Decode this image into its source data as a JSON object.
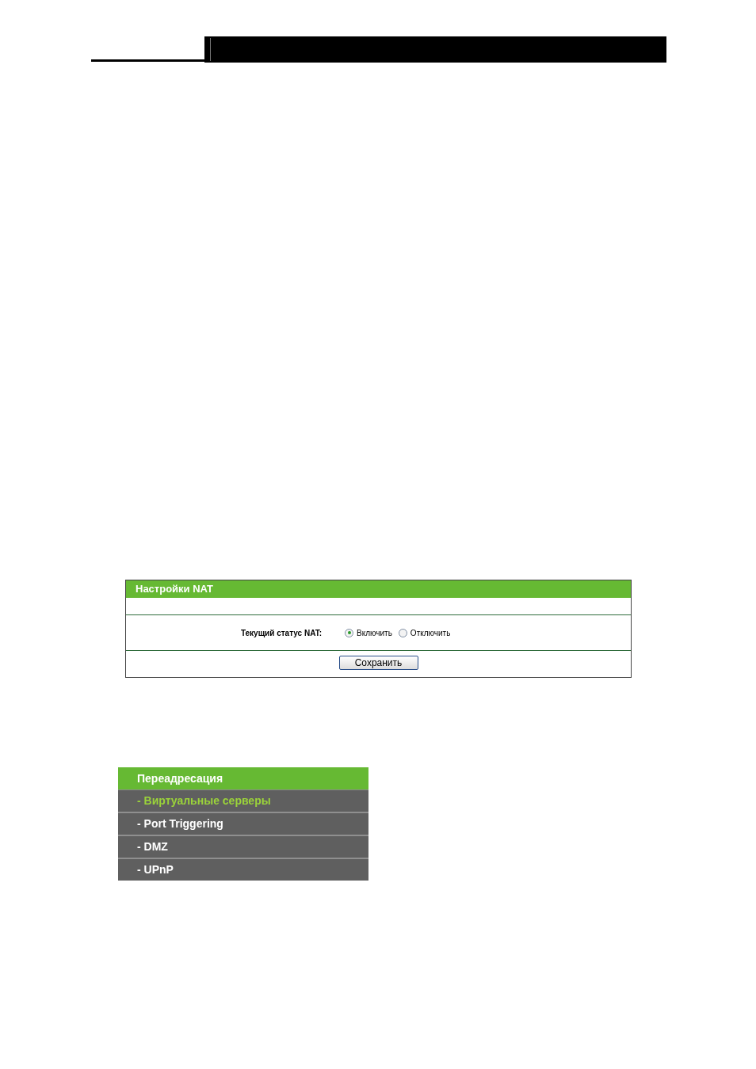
{
  "nat_settings": {
    "title": "Настройки NAT",
    "status_label": "Текущий статус NAT:",
    "options": [
      {
        "label": "Включить",
        "selected": true
      },
      {
        "label": "Отключить",
        "selected": false
      }
    ],
    "save_button": "Сохранить"
  },
  "forwarding_menu": {
    "title": "Переадресация",
    "items": [
      {
        "label": "- Виртуальные серверы",
        "selected": true
      },
      {
        "label": "- Port Triggering",
        "selected": false
      },
      {
        "label": "- DMZ",
        "selected": false
      },
      {
        "label": "- UPnP",
        "selected": false
      }
    ]
  }
}
